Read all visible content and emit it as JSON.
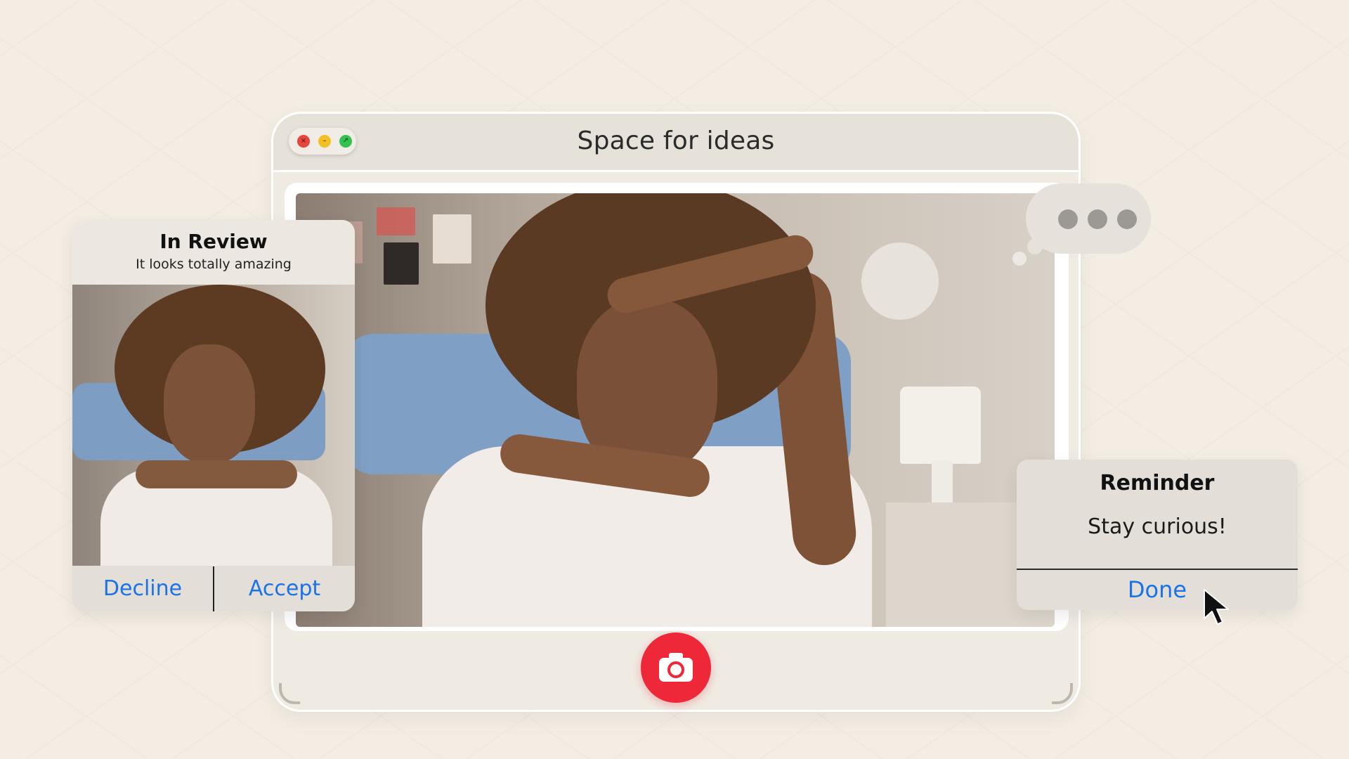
{
  "window": {
    "title": "Space for ideas",
    "controls": {
      "close": "×",
      "minimize": "–",
      "maximize": "↗"
    }
  },
  "review_card": {
    "title": "In Review",
    "subtitle": "It looks totally amazing",
    "decline_label": "Decline",
    "accept_label": "Accept"
  },
  "reminder": {
    "title": "Reminder",
    "message": "Stay curious!",
    "done_label": "Done"
  },
  "icons": {
    "camera": "camera-icon",
    "typing": "typing-indicator-icon",
    "cursor": "mouse-pointer-icon"
  },
  "colors": {
    "background": "#f4ede3",
    "accent_blue": "#1a73e8",
    "shutter_red": "#ee2839",
    "close": "#e8453c",
    "minimize": "#f2c121",
    "maximize": "#33c24f"
  }
}
